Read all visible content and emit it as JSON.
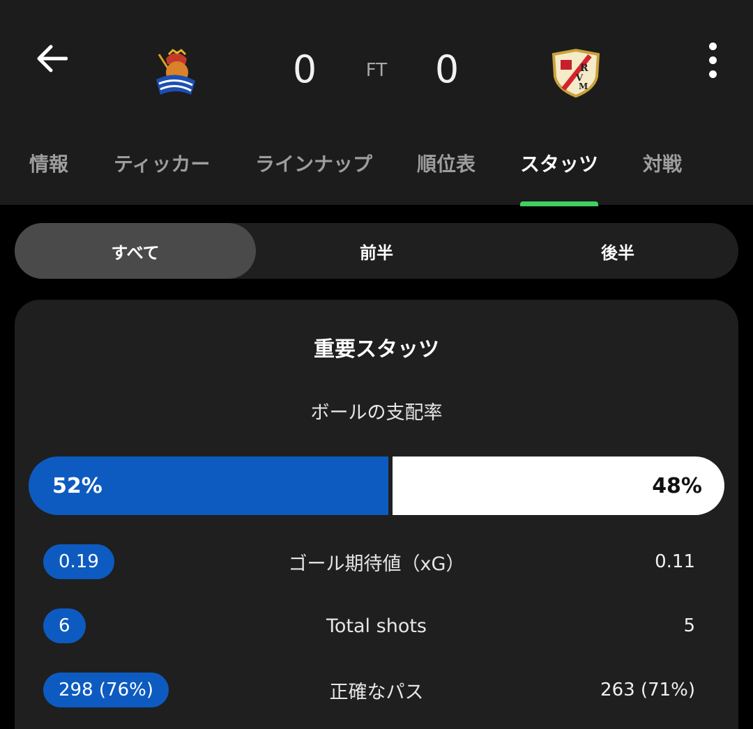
{
  "match": {
    "home_score": "0",
    "away_score": "0",
    "status": "FT",
    "home_team_icon": "real-sociedad-crest",
    "away_team_icon": "rayo-vallecano-crest"
  },
  "icons": {
    "back": "back-arrow-icon",
    "more": "more-vert-icon"
  },
  "tabs": [
    {
      "label": "情報"
    },
    {
      "label": "ティッカー"
    },
    {
      "label": "ラインナップ"
    },
    {
      "label": "順位表"
    },
    {
      "label": "スタッツ",
      "active": true
    },
    {
      "label": "対戦"
    }
  ],
  "period_filter": [
    {
      "label": "すべて",
      "active": true
    },
    {
      "label": "前半"
    },
    {
      "label": "後半"
    }
  ],
  "stats": {
    "section_title": "重要スタッツ",
    "possession": {
      "label": "ボールの支配率",
      "home_text": "52%",
      "away_text": "48%",
      "home_value": 52,
      "away_value": 48
    },
    "rows": [
      {
        "label": "ゴール期待値（xG）",
        "home": "0.19",
        "away": "0.11"
      },
      {
        "label": "Total shots",
        "home": "6",
        "away": "5"
      },
      {
        "label": "正確なパス",
        "home": "298 (76%)",
        "away": "263 (71%)"
      }
    ]
  },
  "colors": {
    "accent": "#3fd05f",
    "home_team": "#0d5bc0",
    "away_team": "#ffffff",
    "background": "#000000",
    "surface": "#1f1f1f"
  }
}
